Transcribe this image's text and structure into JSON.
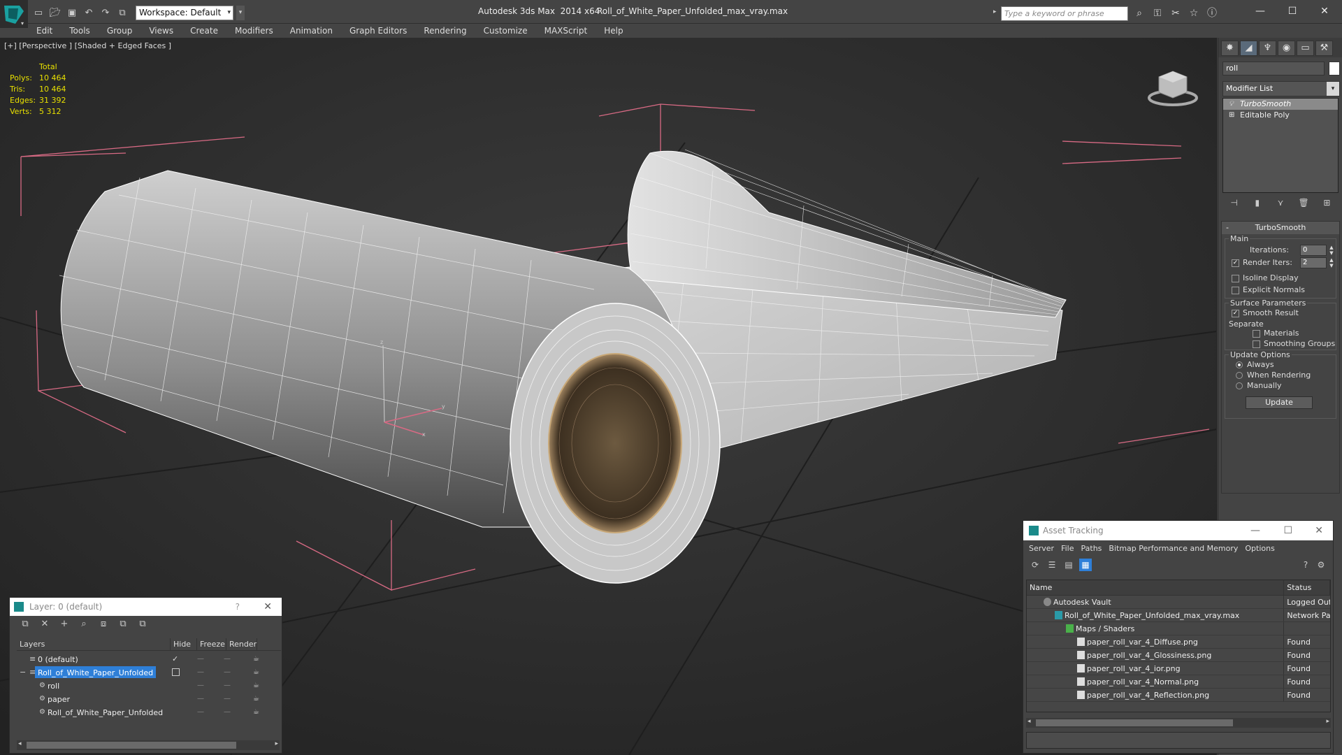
{
  "titlebar": {
    "workspace": "Workspace: Default",
    "app_title": "Autodesk 3ds Max  2014 x64",
    "file_title": "Roll_of_White_Paper_Unfolded_max_vray.max",
    "search_placeholder": "Type a keyword or phrase"
  },
  "menu": [
    "Edit",
    "Tools",
    "Group",
    "Views",
    "Create",
    "Modifiers",
    "Animation",
    "Graph Editors",
    "Rendering",
    "Customize",
    "MAXScript",
    "Help"
  ],
  "viewport": {
    "label": "[+] [Perspective ] [Shaded + Edged Faces ]",
    "stats": {
      "header": "Total",
      "polys_label": "Polys:",
      "polys": "10 464",
      "tris_label": "Tris:",
      "tris": "10 464",
      "edges_label": "Edges:",
      "edges": "31 392",
      "verts_label": "Verts:",
      "verts": "5 312"
    }
  },
  "command_panel": {
    "object_name": "roll",
    "modifier_list": "Modifier List",
    "stack": [
      "TurboSmooth",
      "Editable Poly"
    ],
    "rollout": {
      "title": "TurboSmooth",
      "main": "Main",
      "iterations_label": "Iterations:",
      "iterations": "0",
      "render_iters_label": "Render Iters:",
      "render_iters": "2",
      "isoline": "Isoline Display",
      "explicit_normals": "Explicit Normals",
      "surface_params": "Surface Parameters",
      "smooth_result": "Smooth Result",
      "separate": "Separate",
      "materials": "Materials",
      "smoothing_groups": "Smoothing Groups",
      "update_options": "Update Options",
      "always": "Always",
      "when_rendering": "When Rendering",
      "manually": "Manually",
      "update": "Update"
    }
  },
  "layer_window": {
    "title": "Layer: 0 (default)",
    "help": "?",
    "columns": [
      "Layers",
      "Hide",
      "Freeze",
      "Render"
    ],
    "rows": [
      {
        "name": "0 (default)"
      },
      {
        "name": "Roll_of_White_Paper_Unfolded"
      },
      {
        "name": "roll"
      },
      {
        "name": "paper"
      },
      {
        "name": "Roll_of_White_Paper_Unfolded"
      }
    ]
  },
  "asset_window": {
    "title": "Asset Tracking",
    "menu": [
      "Server",
      "File",
      "Paths",
      "Bitmap Performance and Memory",
      "Options"
    ],
    "columns": [
      "Name",
      "Status"
    ],
    "rows": [
      {
        "name": "Autodesk Vault",
        "status": "Logged Out"
      },
      {
        "name": "Roll_of_White_Paper_Unfolded_max_vray.max",
        "status": "Network Pa"
      },
      {
        "name": "Maps / Shaders",
        "status": ""
      },
      {
        "name": "paper_roll_var_4_Diffuse.png",
        "status": "Found"
      },
      {
        "name": "paper_roll_var_4_Glossiness.png",
        "status": "Found"
      },
      {
        "name": "paper_roll_var_4_ior.png",
        "status": "Found"
      },
      {
        "name": "paper_roll_var_4_Normal.png",
        "status": "Found"
      },
      {
        "name": "paper_roll_var_4_Reflection.png",
        "status": "Found"
      }
    ]
  }
}
